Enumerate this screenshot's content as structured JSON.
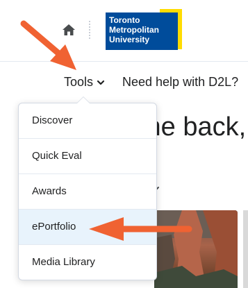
{
  "header": {
    "home_icon": "home-icon",
    "logo_lines": [
      "Toronto",
      "Metropolitan",
      "University"
    ]
  },
  "nav": {
    "tools_label": "Tools",
    "help_label": "Need help with D2L?"
  },
  "main": {
    "welcome_text": "me back,"
  },
  "tools_menu": {
    "items": [
      {
        "label": "Discover"
      },
      {
        "label": "Quick Eval"
      },
      {
        "label": "Awards"
      },
      {
        "label": "ePortfolio"
      },
      {
        "label": "Media Library"
      }
    ],
    "highlighted_item": "ePortfolio"
  },
  "colors": {
    "annotation_arrow": "#f06232",
    "logo_blue": "#004c9b",
    "logo_yellow": "#ffdc00",
    "highlight_bg": "#e8f3fc"
  }
}
